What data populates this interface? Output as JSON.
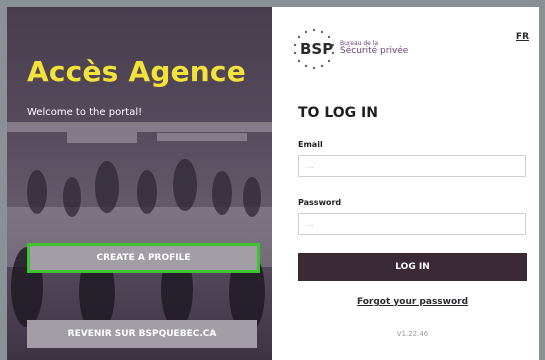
{
  "left": {
    "title": "Accès Agence",
    "welcome": "Welcome to the portal!",
    "create_profile_label": "CREATE A PROFILE",
    "back_label": "REVENIR SUR BSPQUEBEC.CA"
  },
  "right": {
    "logo": {
      "mark": "BSP",
      "line1": "Bureau de la",
      "line2": "Sécurité privée"
    },
    "lang_link": "FR",
    "heading": "TO LOG IN",
    "email_label": "Email",
    "email_placeholder": "...",
    "password_label": "Password",
    "password_placeholder": "...",
    "login_label": "LOG IN",
    "forgot_label": "Forgot your password",
    "version": "V1.22.46"
  },
  "colors": {
    "accent_yellow": "#f2e23a",
    "button_dark": "#3a2a35",
    "highlight_green": "#3ec432",
    "brand_purple": "#6b3f7a"
  },
  "icons": [
    "bsp-logo-icon"
  ]
}
